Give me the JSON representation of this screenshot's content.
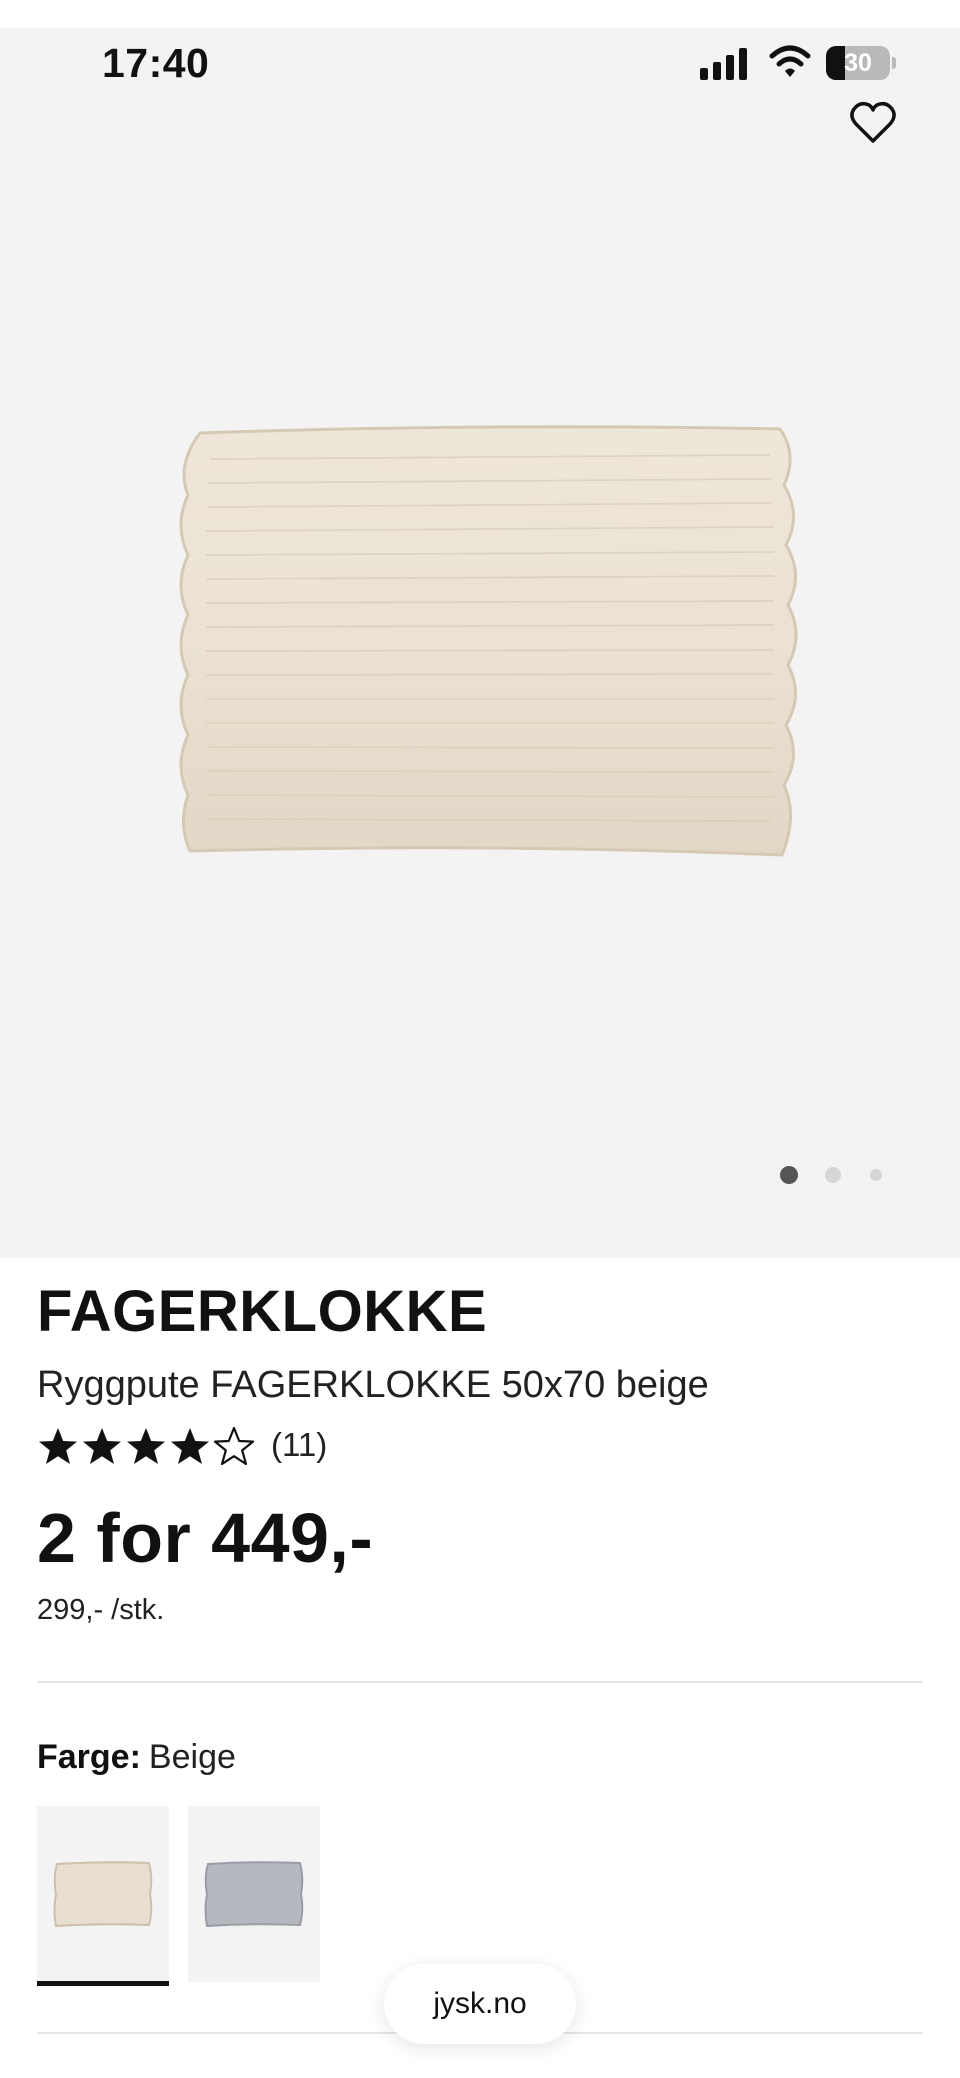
{
  "status_bar": {
    "time": "17:40",
    "battery_level": "30",
    "battery_fraction": 0.3
  },
  "product": {
    "brand": "FAGERKLOKKE",
    "subtitle": "Ryggpute FAGERKLOKKE 50x70 beige",
    "rating": {
      "stars_filled": 4,
      "stars_total": 5,
      "count_text": "(11)"
    },
    "price": "2 for 449,-",
    "unit_price": "299,- /stk.",
    "gallery": {
      "image_count": 3,
      "active_index": 0
    }
  },
  "color": {
    "label": "Farge:",
    "selected": "Beige",
    "options": [
      {
        "name": "beige",
        "hex": "#e8dfd1",
        "selected": true
      },
      {
        "name": "grey",
        "hex": "#b6b8c0",
        "selected": false
      }
    ]
  },
  "browser": {
    "url": "jysk.no"
  },
  "colors": {
    "hero_bg": "#f3f3f3",
    "text": "#111111",
    "divider": "#e6e6e6",
    "pillow": "#ebe3d5"
  },
  "icons": [
    "signal-icon",
    "wifi-icon",
    "battery-icon",
    "heart-icon",
    "star-icon"
  ]
}
